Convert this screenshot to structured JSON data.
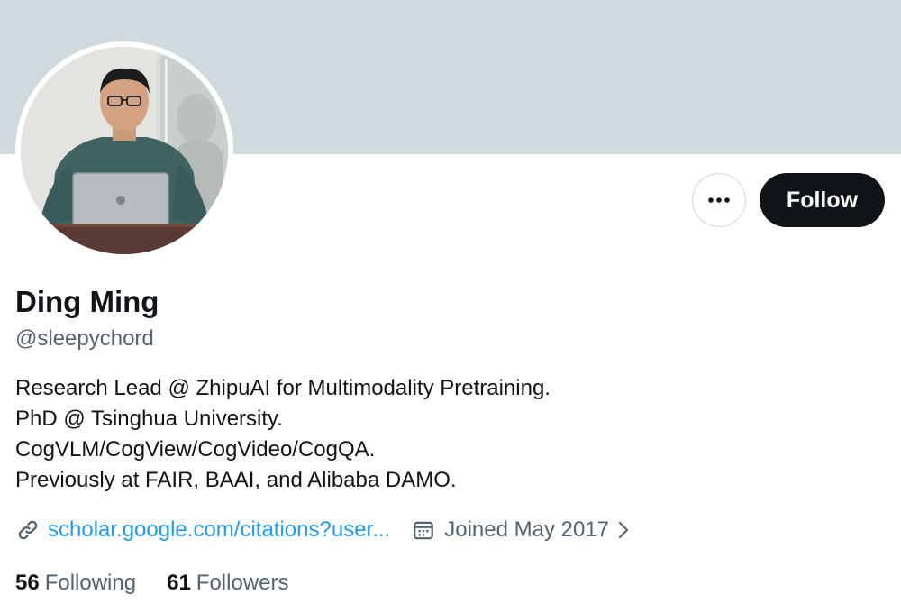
{
  "profile": {
    "display_name": "Ding Ming",
    "handle": "@sleepychord",
    "bio": [
      "Research Lead @ ZhipuAI for Multimodality Pretraining.",
      "PhD @ Tsinghua University.",
      "CogVLM/CogView/CogVideo/CogQA.",
      "Previously at FAIR, BAAI, and Alibaba DAMO."
    ],
    "website_text": "scholar.google.com/citations?user...",
    "joined_text": "Joined May 2017",
    "avatar_icon": "profile-photo"
  },
  "actions": {
    "more_icon": "more-dots-icon",
    "follow_label": "Follow"
  },
  "stats": {
    "following_count": "56",
    "following_label": "Following",
    "followers_count": "61",
    "followers_label": "Followers"
  },
  "colors": {
    "banner": "#cfd9de",
    "primary_text": "#0f1419",
    "secondary_text": "#536471",
    "link": "#1d9bf0",
    "follow_button_bg": "#0f1419"
  }
}
